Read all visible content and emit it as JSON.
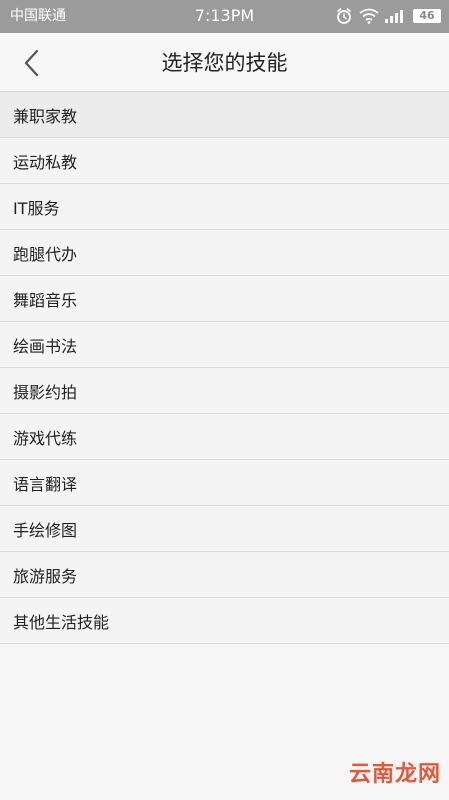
{
  "status_bar": {
    "carrier": "中国联通",
    "time": "7:13PM",
    "battery": "46",
    "icons": [
      "alarm-icon",
      "wifi-icon",
      "signal-icon",
      "battery-icon"
    ]
  },
  "header": {
    "title": "选择您的技能",
    "back_icon": "chevron-left-icon"
  },
  "skills": [
    {
      "label": "兼职家教"
    },
    {
      "label": "运动私教"
    },
    {
      "label": "IT服务"
    },
    {
      "label": "跑腿代办"
    },
    {
      "label": "舞蹈音乐"
    },
    {
      "label": "绘画书法"
    },
    {
      "label": "摄影约拍"
    },
    {
      "label": "游戏代练"
    },
    {
      "label": "语言翻译"
    },
    {
      "label": "手绘修图"
    },
    {
      "label": "旅游服务"
    },
    {
      "label": "其他生活技能"
    }
  ],
  "watermark": {
    "text": "云南龙网"
  },
  "colors": {
    "status_bar_bg": "#9b9b9b",
    "page_bg": "#f6f6f6",
    "divider": "#dcdcdc",
    "watermark": "#e05a3a"
  }
}
